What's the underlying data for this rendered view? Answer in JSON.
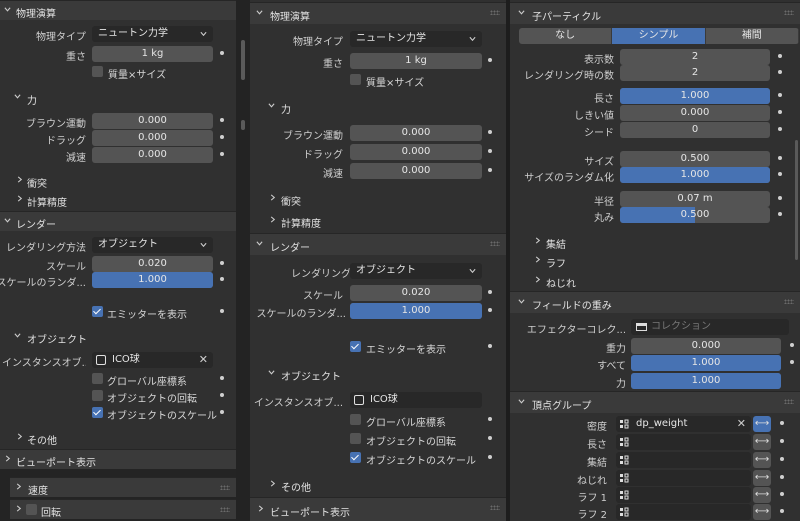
{
  "physics_header": "物理演算",
  "physics_type_label": "物理タイプ",
  "physics_type_value": "ニュートン力学",
  "mass_label": "重さ",
  "mass_value": "1 kg",
  "mass_size_label": "質量×サイズ",
  "force_header": "力",
  "brownian_label": "ブラウン運動",
  "brownian_value": "0.000",
  "drag_label": "ドラッグ",
  "drag_value": "0.000",
  "damp_label": "減速",
  "damp_value": "0.000",
  "collision_header": "衝突",
  "accuracy_header": "計算精度",
  "render_header": "レンダー",
  "render_as_label": "レンダリング方法",
  "render_as_value": "オブジェクト",
  "scale_label": "スケール",
  "scale_value": "0.020",
  "scale_rand_label": "スケールのランダ...",
  "scale_rand_value": "1.000",
  "scale_rand_fraction": 1.0,
  "show_emitter_label": "エミッターを表示",
  "object_header": "オブジェクト",
  "instance_label": "インスタンスオブ...",
  "instance_value": "ICO球",
  "global_coords_label": "グローバル座標系",
  "object_rotation_label": "オブジェクトの回転",
  "object_scale_label": "オブジェクトのスケール",
  "other_header": "その他",
  "viewport_header": "ビューポート表示",
  "velocity_header": "速度",
  "rotation_header": "回転",
  "children_header": "子パーティクル",
  "children_modes": [
    "なし",
    "シンプル",
    "補間"
  ],
  "display_amount_label": "表示数",
  "display_amount_value": "2",
  "render_amount_label": "レンダリング時の数",
  "render_amount_value": "2",
  "length_label": "長さ",
  "length_value": "1.000",
  "length_fraction": 1.0,
  "threshold_label": "しきい値",
  "threshold_value": "0.000",
  "seed_label": "シード",
  "seed_value": "0",
  "size_label": "サイズ",
  "size_value": "0.500",
  "size_rand_label": "サイズのランダム化",
  "size_rand_value": "1.000",
  "size_rand_fraction": 1.0,
  "radius_label": "半径",
  "radius_value": "0.07 m",
  "roundness_label": "丸み",
  "roundness_value": "0.500",
  "roundness_fraction": 0.5,
  "clump_header": "集結",
  "rough_header": "ラフ",
  "kink_header": "ねじれ",
  "field_weights_header": "フィールドの重み",
  "effector_collection_label": "エフェクターコレク...",
  "effector_collection_placeholder": "コレクション",
  "gravity_label": "重力",
  "gravity_value": "0.000",
  "all_label": "すべて",
  "all_value": "1.000",
  "all_fraction": 1.0,
  "force_label": "力",
  "force_value": "1.000",
  "force_fraction": 1.0,
  "vertex_groups_header": "頂点グループ",
  "density_label": "密度",
  "density_value": "dp_weight",
  "vg_length_label": "長さ",
  "vg_clump_label": "集結",
  "vg_kink_label": "ねじれ",
  "vg_rough1_label": "ラフ 1",
  "vg_rough2_label": "ラフ 2",
  "invert_glyph": "⟷",
  "clear_glyph": "✕",
  "colors": {
    "accent": "#4772b3",
    "panel": "#303030",
    "field": "#545454",
    "header": "#3a3a3a"
  }
}
